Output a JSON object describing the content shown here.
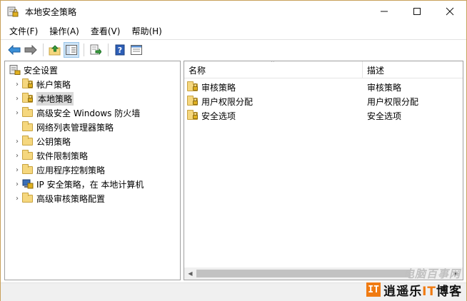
{
  "window": {
    "title": "本地安全策略",
    "controls": [
      "—",
      "☐",
      "✕"
    ]
  },
  "menu": [
    "文件(F)",
    "操作(A)",
    "查看(V)",
    "帮助(H)"
  ],
  "toolbar": [
    "back-arrow",
    "forward-arrow",
    "up-folder",
    "show-hide-tree",
    "export-list",
    "help",
    "properties"
  ],
  "tree": {
    "root": "安全设置",
    "items": [
      {
        "label": "帐户策略",
        "expandable": true,
        "icon": "folder-lock"
      },
      {
        "label": "本地策略",
        "expandable": true,
        "icon": "folder-lock",
        "selected": true
      },
      {
        "label": "高级安全 Windows 防火墙",
        "expandable": true,
        "icon": "folder"
      },
      {
        "label": "网络列表管理器策略",
        "expandable": false,
        "icon": "folder"
      },
      {
        "label": "公钥策略",
        "expandable": true,
        "icon": "folder"
      },
      {
        "label": "软件限制策略",
        "expandable": true,
        "icon": "folder"
      },
      {
        "label": "应用程序控制策略",
        "expandable": true,
        "icon": "folder"
      },
      {
        "label": "IP 安全策略，在 本地计算机",
        "expandable": true,
        "icon": "ip-security"
      },
      {
        "label": "高级审核策略配置",
        "expandable": true,
        "icon": "folder"
      }
    ]
  },
  "list": {
    "columns": {
      "name": "名称",
      "description": "描述"
    },
    "rows": [
      {
        "name": "审核策略",
        "description": "审核策略"
      },
      {
        "name": "用户权限分配",
        "description": "用户权限分配"
      },
      {
        "name": "安全选项",
        "description": "安全选项"
      }
    ]
  },
  "watermark": {
    "upper": "电脑百事网",
    "badge": "IT",
    "text_a": "逍遥乐",
    "text_it": "IT",
    "text_b": "博客"
  },
  "colors": {
    "accent_border": "#c8a05a",
    "selection": "#d9d9d9",
    "watermark_orange": "#f07b12"
  }
}
